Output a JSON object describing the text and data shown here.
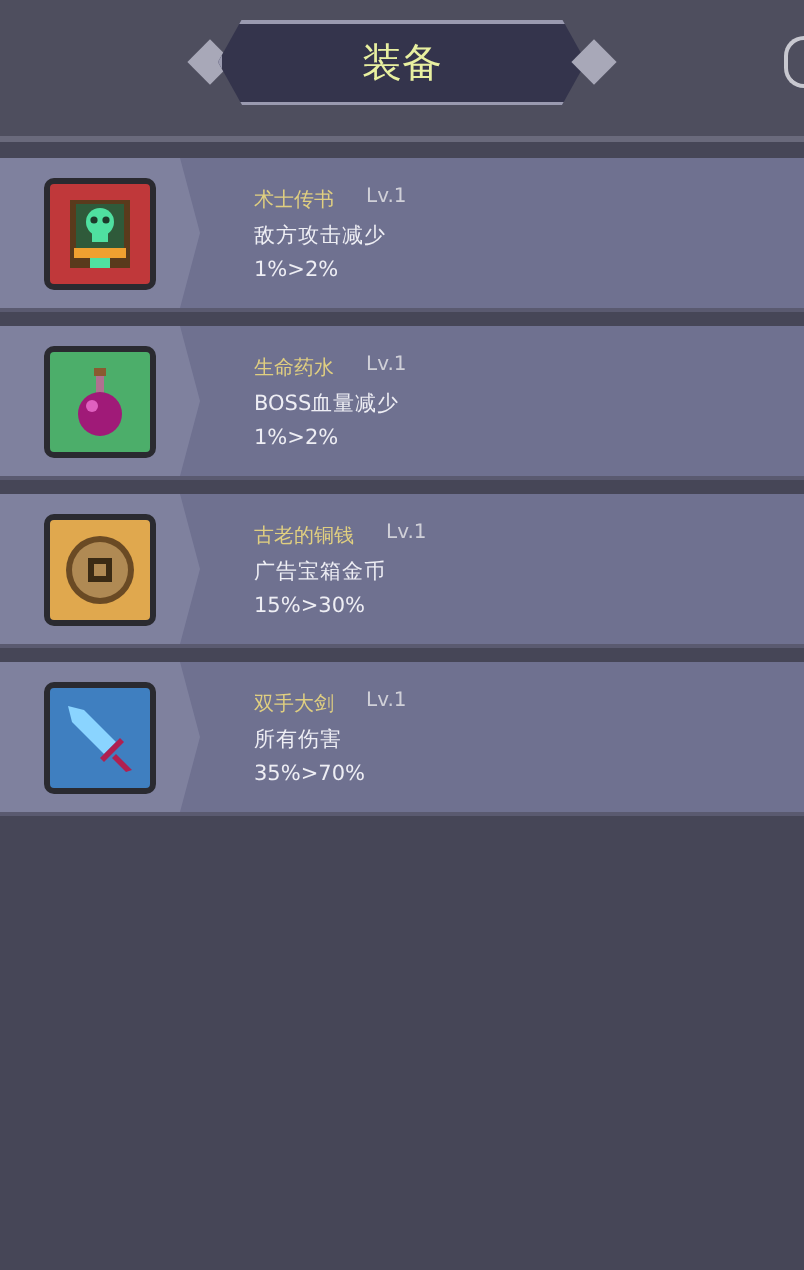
{
  "header": {
    "title": "装备"
  },
  "items": [
    {
      "kind": "book",
      "color": "#c0383a",
      "name": "术士传书",
      "level": "Lv.1",
      "effect": "敌方攻击减少",
      "value": "1%>2%"
    },
    {
      "kind": "potion",
      "color": "#4cae6a",
      "name": "生命药水",
      "level": "Lv.1",
      "effect": "BOSS血量减少",
      "value": "1%>2%"
    },
    {
      "kind": "coin",
      "color": "#e0a84e",
      "name": "古老的铜钱",
      "level": "Lv.1",
      "effect": "广告宝箱金币",
      "value": "15%>30%"
    },
    {
      "kind": "sword",
      "color": "#3f7fc0",
      "name": "双手大剑",
      "level": "Lv.1",
      "effect": "所有伤害",
      "value": "35%>70%"
    }
  ]
}
